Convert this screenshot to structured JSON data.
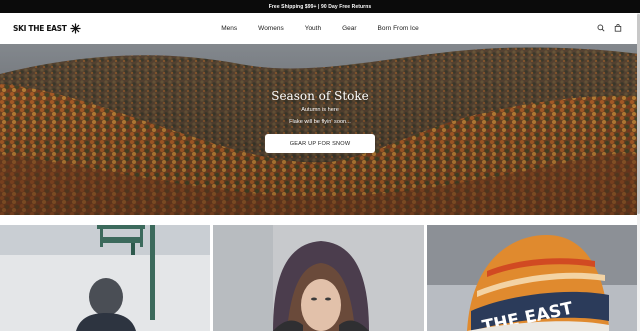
{
  "announcement": "Free Shipping $99+ | 90 Day Free Returns",
  "brand": {
    "name": "SKI THE EAST"
  },
  "nav": [
    {
      "label": "Mens"
    },
    {
      "label": "Womens"
    },
    {
      "label": "Youth"
    },
    {
      "label": "Gear"
    },
    {
      "label": "Born From Ice"
    }
  ],
  "header_icons": [
    "search-icon",
    "cart-icon"
  ],
  "hero": {
    "title": "Season of Stoke",
    "line1": "Autumn is here",
    "line2": "Flake will be flyin' soon...",
    "cta": "GEAR UP FOR SNOW"
  },
  "colors": {
    "announcement_bg": "#0b0b0b",
    "foliage_orange": "#b8642a",
    "foliage_green": "#3e4a2a"
  }
}
